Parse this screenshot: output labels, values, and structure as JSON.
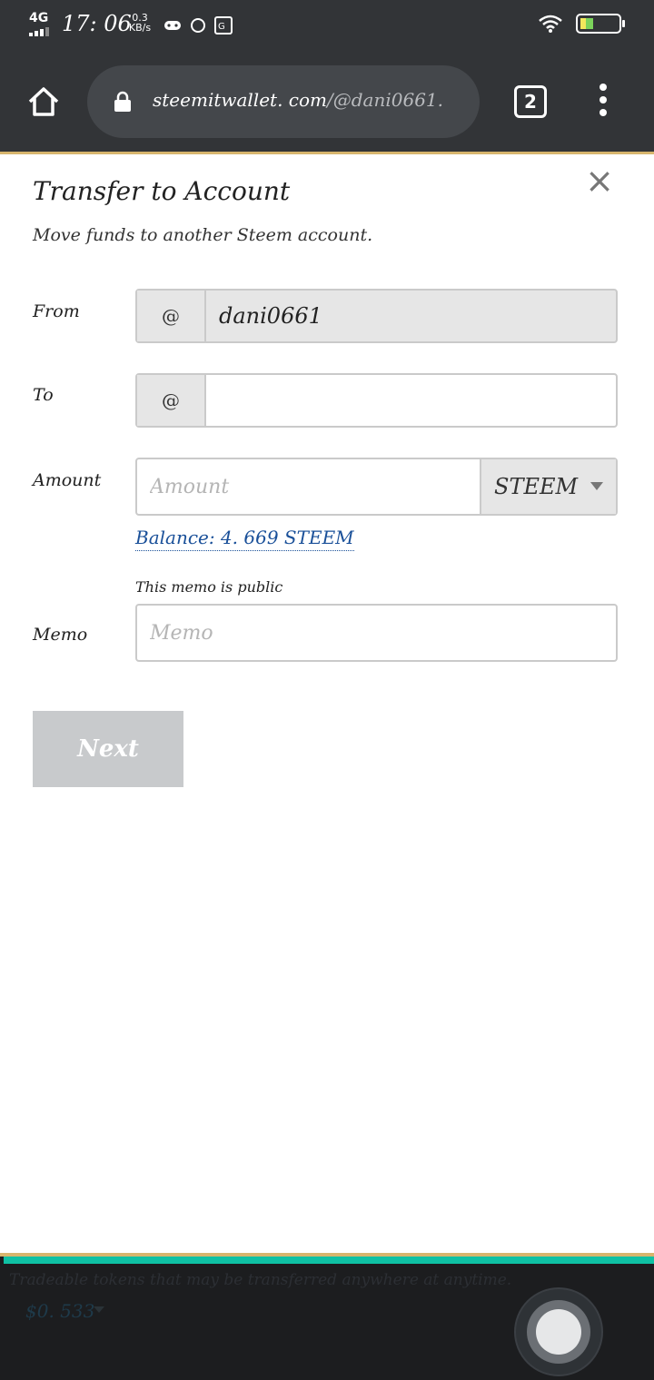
{
  "status_bar": {
    "network": "4G",
    "time": "17: 06",
    "speed_value": "0.3",
    "speed_unit": "KB/s"
  },
  "browser": {
    "url_host": "steemitwallet. com",
    "url_path": "/@dani0661.",
    "tab_count": "2"
  },
  "transfer_modal": {
    "title": "Transfer to Account",
    "subtitle": "Move funds to another Steem account.",
    "from_label": "From",
    "from_prefix": "@",
    "from_value": "dani0661",
    "to_label": "To",
    "to_prefix": "@",
    "to_value": "",
    "amount_label": "Amount",
    "amount_placeholder": "Amount",
    "asset_selected": "STEEM",
    "balance_text": "Balance:  4. 669 STEEM",
    "memo_note": "This memo is public",
    "memo_label": "Memo",
    "memo_placeholder": "Memo",
    "next_label": "Next",
    "close_symbol": "×"
  },
  "background_page": {
    "tradeable_text": "Tradeable tokens that may be transferred anywhere at anytime.",
    "balance_value": "$0. 533"
  },
  "colors": {
    "browser_chrome": "#323437",
    "url_bar": "#44474b",
    "accent_gold": "#d7b56d",
    "accent_teal": "#0fc1a4",
    "balance_link": "#1a5099",
    "next_button_disabled": "#c8cacc",
    "input_addon": "#e6e6e6"
  }
}
